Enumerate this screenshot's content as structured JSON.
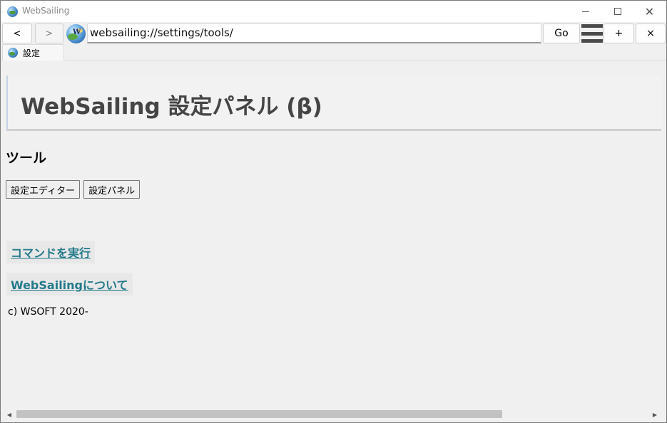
{
  "window": {
    "title": "WebSailing",
    "controls": {
      "minimize": "minimize",
      "maximize": "maximize",
      "close": "close"
    }
  },
  "nav": {
    "back_label": "<",
    "forward_label": ">",
    "globe_letter": "W",
    "address": "websailing://settings/tools/",
    "go_label": "Go",
    "new_tab_label": "+",
    "close_tab_label": "×"
  },
  "tabs": [
    {
      "label": "設定",
      "active": true
    }
  ],
  "page": {
    "header_title": "WebSailing 設定パネル (β)",
    "section_title": "ツール",
    "tool_buttons": [
      {
        "label": "設定エディター"
      },
      {
        "label": "設定パネル"
      }
    ],
    "links": [
      {
        "label": "コマンドを実行"
      },
      {
        "label": "WebSailingについて"
      }
    ],
    "copyright": "c) WSOFT 2020-"
  },
  "colors": {
    "link": "#237a8a",
    "header_text": "#454545",
    "window_bg": "#f0f0f0"
  },
  "icons": [
    "app-globe-icon",
    "globe-icon",
    "hamburger-menu-icon",
    "minimize-icon",
    "maximize-icon",
    "close-icon",
    "scroll-left-arrow-icon",
    "scroll-right-arrow-icon"
  ]
}
